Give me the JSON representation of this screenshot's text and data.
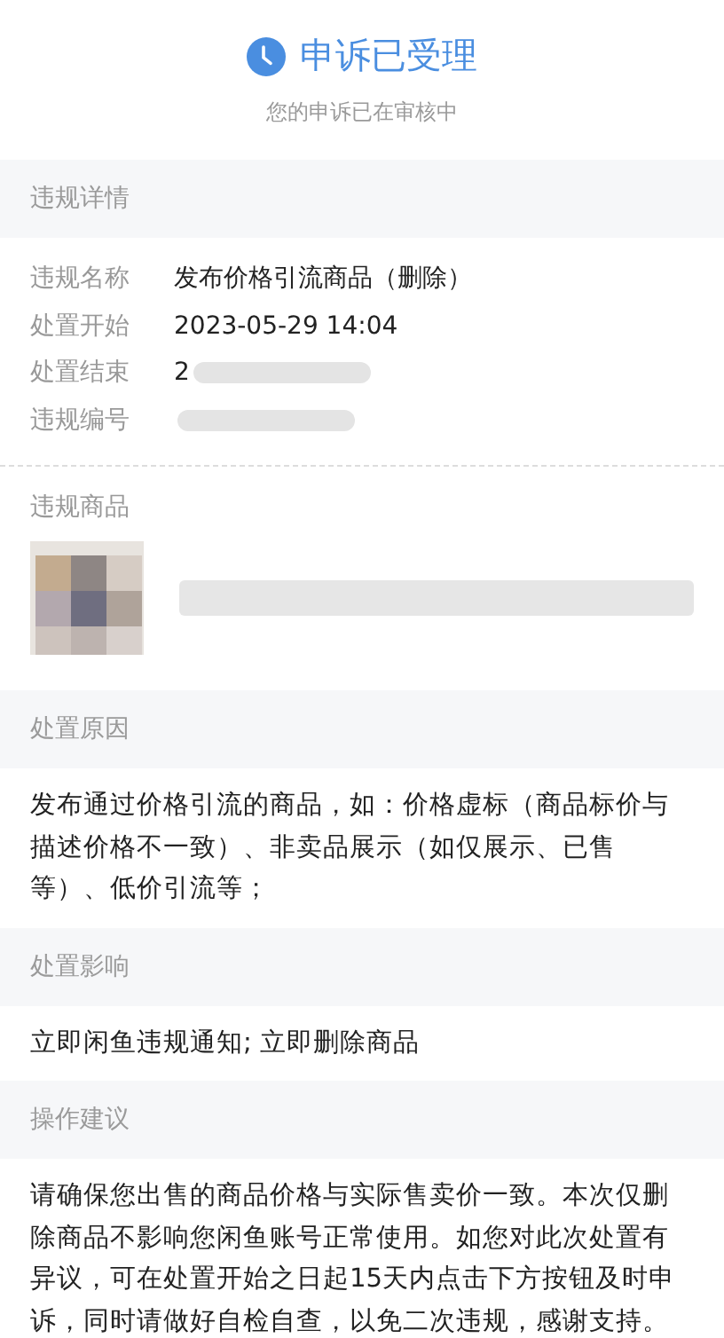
{
  "status": {
    "title": "申诉已受理",
    "subtitle": "您的申诉已在审核中"
  },
  "details": {
    "heading": "违规详情",
    "rows": [
      {
        "label": "违规名称",
        "value": "发布价格引流商品（删除）",
        "redacted": false
      },
      {
        "label": "处置开始",
        "value": "2023-05-29 14:04",
        "redacted": false
      },
      {
        "label": "处置结束",
        "value": "2",
        "redacted": true
      },
      {
        "label": "违规编号",
        "value": "",
        "redacted": true
      }
    ]
  },
  "goods": {
    "heading": "违规商品",
    "redacted": true
  },
  "sections": [
    {
      "heading": "处置原因",
      "text": "发布通过价格引流的商品，如：价格虚标（商品标价与描述价格不一致）、非卖品展示（如仅展示、已售等）、低价引流等；"
    },
    {
      "heading": "处置影响",
      "text": "立即闲鱼违规通知; 立即删除商品"
    },
    {
      "heading": "操作建议",
      "text": "请确保您出售的商品价格与实际售卖价一致。本次仅删除商品不影响您闲鱼账号正常使用。如您对此次处置有异议，可在处置开始之日起15天内点击下方按钮及时申诉，同时请做好自检自查，以免二次违规，感谢支持。"
    }
  ]
}
